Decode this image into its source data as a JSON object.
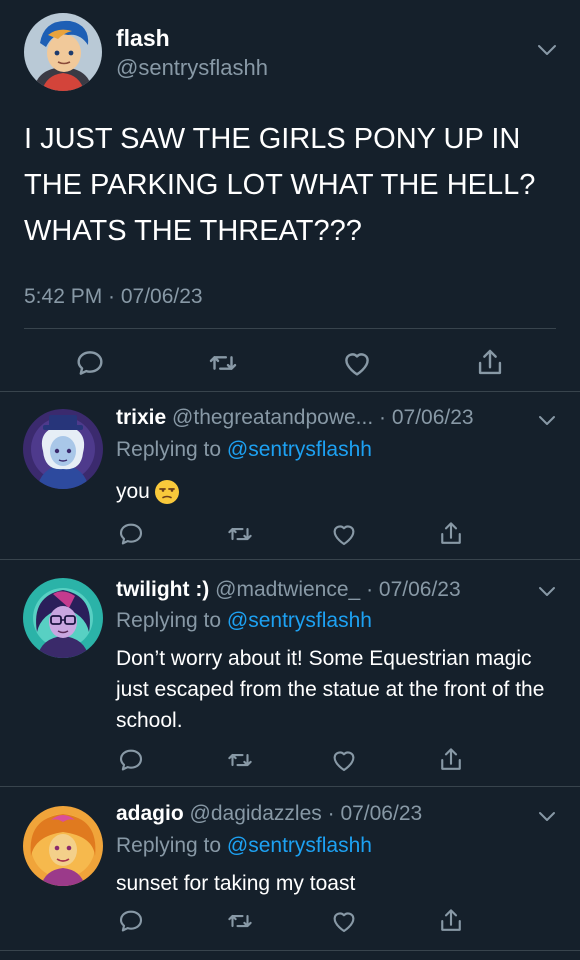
{
  "main_tweet": {
    "name": "flash",
    "handle": "@sentrysflashh",
    "text": "I JUST SAW THE GIRLS PONY UP IN THE PARKING LOT WHAT THE HELL? WHATS THE THREAT???",
    "timestamp": "5:42 PM · 07/06/23",
    "avatar_icon": "flash-avatar",
    "actions": [
      "reply-icon",
      "retweet-icon",
      "like-icon",
      "share-icon"
    ]
  },
  "replies": [
    {
      "name": "trixie",
      "handle": "@thegreatandpowe...",
      "date": "07/06/23",
      "replying_prefix": "Replying to",
      "replying_to": "@sentrysflashh",
      "text": "you",
      "emoji": "unamused-face-emoji",
      "avatar_icon": "trixie-avatar"
    },
    {
      "name": "twilight :)",
      "handle": "@madtwience_",
      "date": "07/06/23",
      "replying_prefix": "Replying to",
      "replying_to": "@sentrysflashh",
      "text": "Don’t worry about it! Some Equestrian magic just escaped from the statue at the front of the school.",
      "avatar_icon": "twilight-avatar"
    },
    {
      "name": "adagio",
      "handle": "@dagidazzles",
      "date": "07/06/23",
      "replying_prefix": "Replying to",
      "replying_to": "@sentrysflashh",
      "text": "sunset for taking my toast",
      "avatar_icon": "adagio-avatar"
    }
  ],
  "colors": {
    "background": "#15202b",
    "text": "#ffffff",
    "secondary": "#8899a6",
    "link": "#1da1f2",
    "divider": "#38444d"
  }
}
